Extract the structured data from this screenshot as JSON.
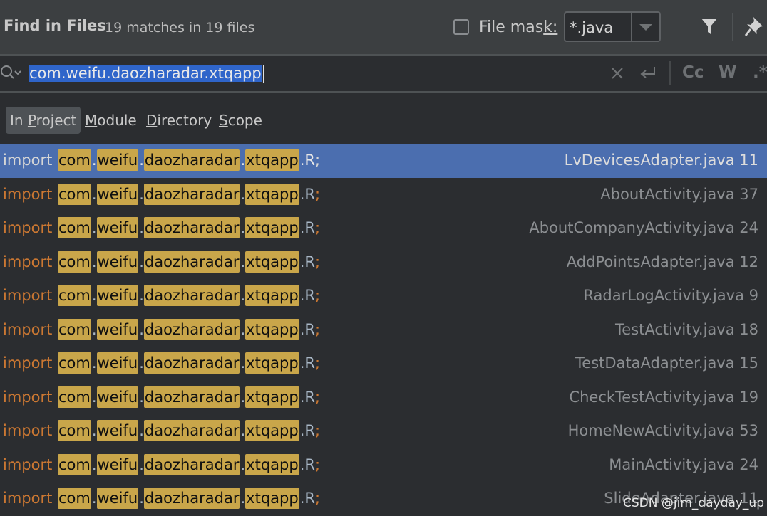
{
  "header": {
    "title": "Find in Files",
    "matches": "19 matches in 19 files",
    "file_mask_label_pre": "File mas",
    "file_mask_label_u": "k:",
    "file_mask_value": "*.java"
  },
  "search": {
    "query": "com.weifu.daozharadar.xtqapp",
    "cc_label": "Cc",
    "w_label": "W",
    "regex_label": ".*"
  },
  "scopes": [
    {
      "pre": "In ",
      "u": "P",
      "post": "roject"
    },
    {
      "pre": "",
      "u": "M",
      "post": "odule"
    },
    {
      "pre": "",
      "u": "D",
      "post": "irectory"
    },
    {
      "pre": "",
      "u": "S",
      "post": "cope"
    }
  ],
  "result_parts": {
    "keyword": "import",
    "segments": [
      "com",
      "weifu",
      "daozharadar",
      "xtqapp"
    ],
    "dot": ".",
    "suffix": ".R",
    "semicolon": ";"
  },
  "results": [
    {
      "file": "LvDevicesAdapter.java 11",
      "selected": true
    },
    {
      "file": "AboutActivity.java 37"
    },
    {
      "file": "AboutCompanyActivity.java 24"
    },
    {
      "file": "AddPointsAdapter.java 12"
    },
    {
      "file": "RadarLogActivity.java 9"
    },
    {
      "file": "TestActivity.java 18"
    },
    {
      "file": "TestDataAdapter.java 15"
    },
    {
      "file": "CheckTestActivity.java 19"
    },
    {
      "file": "HomeNewActivity.java 53"
    },
    {
      "file": "MainActivity.java 24"
    },
    {
      "file": "SlideAdapter.java 11"
    }
  ],
  "watermark": "CSDN @jim_dayday_up",
  "colors": {
    "background": "#2b2d30",
    "header": "#3c3f41",
    "selection": "#4b6eaf",
    "highlight": "#c9a64a",
    "keyword": "#cc7832"
  }
}
